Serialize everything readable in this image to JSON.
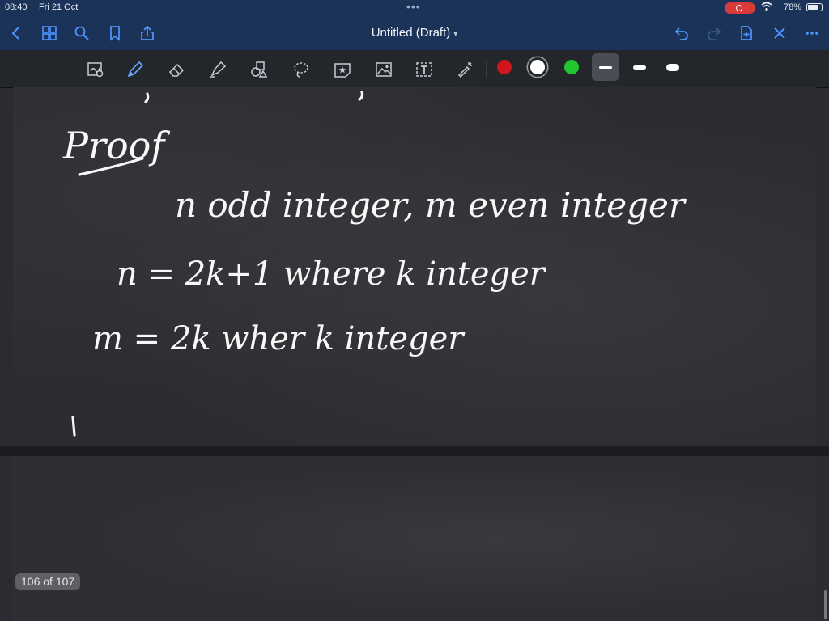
{
  "status_bar": {
    "time": "08:40",
    "date": "Fri 21 Oct",
    "battery": "78%",
    "battery_level": 0.78
  },
  "nav": {
    "title": "Untitled (Draft)",
    "icons": [
      "back-icon",
      "thumbnails-icon",
      "search-icon",
      "bookmark-icon",
      "share-icon",
      "undo-icon",
      "redo-icon",
      "add-page-icon",
      "close-icon",
      "more-icon"
    ]
  },
  "toolbar": {
    "tools": [
      "zoom-box-icon",
      "pen-icon",
      "eraser-icon",
      "highlighter-icon",
      "shapes-icon",
      "lasso-icon",
      "sticker-icon",
      "image-icon",
      "text-box-icon",
      "laser-pointer-icon"
    ],
    "colors": [
      "#d0161b",
      "#ffffff",
      "#21c52f"
    ],
    "stroke_widths": [
      "thin",
      "medium",
      "thick"
    ],
    "selected_stroke": "thin"
  },
  "handwriting": {
    "line1": "Proof",
    "line2": "n odd integer, m even integer",
    "line3": "n = 2k+1   where   k   integer",
    "line4": "m = 2k   wher   k   integer"
  },
  "page_indicator": "106 of 107"
}
